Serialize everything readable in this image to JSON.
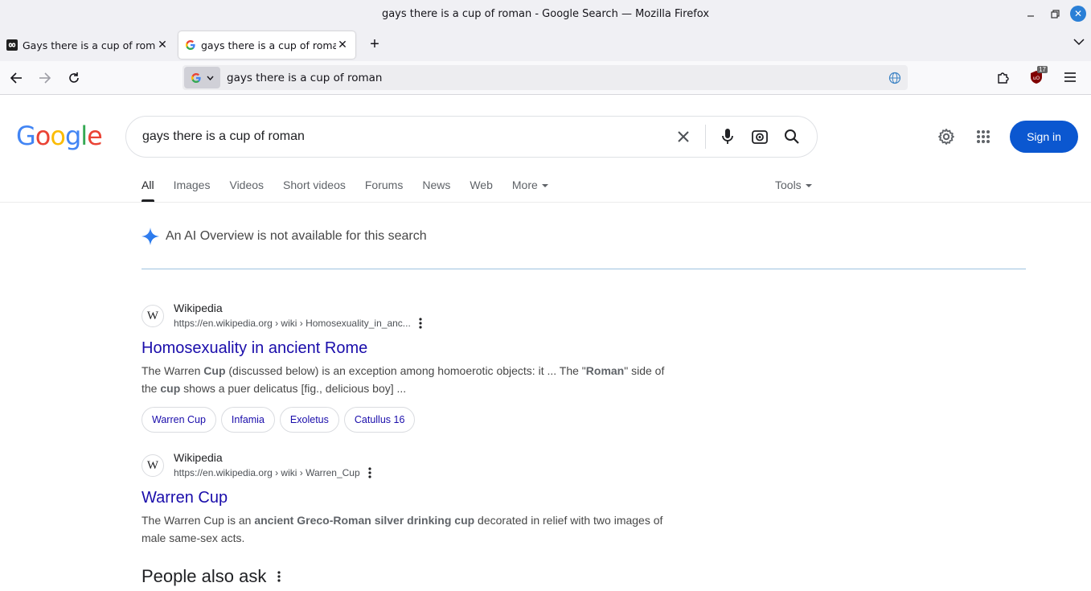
{
  "window": {
    "title": "gays there is a cup of roman - Google Search — Mozilla Firefox"
  },
  "tabs": [
    {
      "label": "Gays there is a cup of roman",
      "active": false,
      "icon": "infinity-icon"
    },
    {
      "label": "gays there is a cup of roman",
      "active": true,
      "icon": "google-g-icon"
    }
  ],
  "urlbar": {
    "value": "gays there is a cup of roman"
  },
  "extension_badge": "17",
  "google": {
    "logo": [
      "G",
      "o",
      "o",
      "g",
      "l",
      "e"
    ],
    "logo_colors": [
      "#4285F4",
      "#EA4335",
      "#FBBC05",
      "#4285F4",
      "#34A853",
      "#EA4335"
    ],
    "query": "gays there is a cup of roman",
    "sign_in": "Sign in",
    "brand_color": "#0b57d0"
  },
  "search_tabs": {
    "items": [
      "All",
      "Images",
      "Videos",
      "Short videos",
      "Forums",
      "News",
      "Web",
      "More"
    ],
    "active": "All",
    "tools": "Tools"
  },
  "ai_overview": {
    "text": "An AI Overview is not available for this search"
  },
  "results": [
    {
      "site": "Wikipedia",
      "url": "https://en.wikipedia.org › wiki › Homosexuality_in_anc...",
      "title": "Homosexuality in ancient Rome",
      "snippet_parts": [
        [
          "The Warren ",
          false
        ],
        [
          "Cup",
          true
        ],
        [
          " (discussed below) is an exception among homoerotic objects: it ... The \"",
          false
        ],
        [
          "Roman",
          true
        ],
        [
          "\" side of the ",
          false
        ],
        [
          "cup",
          true
        ],
        [
          " shows a puer delicatus [fig., delicious boy] ...",
          false
        ]
      ],
      "chips": [
        "Warren Cup",
        "Infamia",
        "Exoletus",
        "Catullus 16"
      ]
    },
    {
      "site": "Wikipedia",
      "url": "https://en.wikipedia.org › wiki › Warren_Cup",
      "title": "Warren Cup",
      "snippet_parts": [
        [
          "The Warren Cup is an ",
          false
        ],
        [
          "ancient Greco-Roman silver drinking cup",
          true
        ],
        [
          " decorated in relief with two images of male same-sex acts.",
          false
        ]
      ],
      "chips": []
    }
  ],
  "people_also_ask": {
    "heading": "People also ask"
  }
}
